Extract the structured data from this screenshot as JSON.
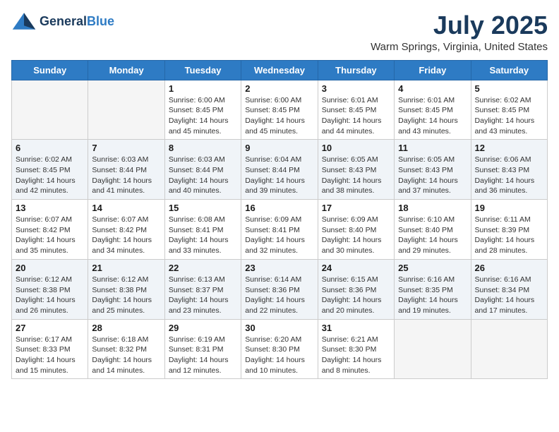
{
  "header": {
    "logo_general": "General",
    "logo_blue": "Blue",
    "month_year": "July 2025",
    "location": "Warm Springs, Virginia, United States"
  },
  "days_of_week": [
    "Sunday",
    "Monday",
    "Tuesday",
    "Wednesday",
    "Thursday",
    "Friday",
    "Saturday"
  ],
  "weeks": [
    [
      {
        "day": "",
        "empty": true
      },
      {
        "day": "",
        "empty": true
      },
      {
        "day": "1",
        "sunrise": "Sunrise: 6:00 AM",
        "sunset": "Sunset: 8:45 PM",
        "daylight": "Daylight: 14 hours and 45 minutes."
      },
      {
        "day": "2",
        "sunrise": "Sunrise: 6:00 AM",
        "sunset": "Sunset: 8:45 PM",
        "daylight": "Daylight: 14 hours and 45 minutes."
      },
      {
        "day": "3",
        "sunrise": "Sunrise: 6:01 AM",
        "sunset": "Sunset: 8:45 PM",
        "daylight": "Daylight: 14 hours and 44 minutes."
      },
      {
        "day": "4",
        "sunrise": "Sunrise: 6:01 AM",
        "sunset": "Sunset: 8:45 PM",
        "daylight": "Daylight: 14 hours and 43 minutes."
      },
      {
        "day": "5",
        "sunrise": "Sunrise: 6:02 AM",
        "sunset": "Sunset: 8:45 PM",
        "daylight": "Daylight: 14 hours and 43 minutes."
      }
    ],
    [
      {
        "day": "6",
        "sunrise": "Sunrise: 6:02 AM",
        "sunset": "Sunset: 8:45 PM",
        "daylight": "Daylight: 14 hours and 42 minutes."
      },
      {
        "day": "7",
        "sunrise": "Sunrise: 6:03 AM",
        "sunset": "Sunset: 8:44 PM",
        "daylight": "Daylight: 14 hours and 41 minutes."
      },
      {
        "day": "8",
        "sunrise": "Sunrise: 6:03 AM",
        "sunset": "Sunset: 8:44 PM",
        "daylight": "Daylight: 14 hours and 40 minutes."
      },
      {
        "day": "9",
        "sunrise": "Sunrise: 6:04 AM",
        "sunset": "Sunset: 8:44 PM",
        "daylight": "Daylight: 14 hours and 39 minutes."
      },
      {
        "day": "10",
        "sunrise": "Sunrise: 6:05 AM",
        "sunset": "Sunset: 8:43 PM",
        "daylight": "Daylight: 14 hours and 38 minutes."
      },
      {
        "day": "11",
        "sunrise": "Sunrise: 6:05 AM",
        "sunset": "Sunset: 8:43 PM",
        "daylight": "Daylight: 14 hours and 37 minutes."
      },
      {
        "day": "12",
        "sunrise": "Sunrise: 6:06 AM",
        "sunset": "Sunset: 8:43 PM",
        "daylight": "Daylight: 14 hours and 36 minutes."
      }
    ],
    [
      {
        "day": "13",
        "sunrise": "Sunrise: 6:07 AM",
        "sunset": "Sunset: 8:42 PM",
        "daylight": "Daylight: 14 hours and 35 minutes."
      },
      {
        "day": "14",
        "sunrise": "Sunrise: 6:07 AM",
        "sunset": "Sunset: 8:42 PM",
        "daylight": "Daylight: 14 hours and 34 minutes."
      },
      {
        "day": "15",
        "sunrise": "Sunrise: 6:08 AM",
        "sunset": "Sunset: 8:41 PM",
        "daylight": "Daylight: 14 hours and 33 minutes."
      },
      {
        "day": "16",
        "sunrise": "Sunrise: 6:09 AM",
        "sunset": "Sunset: 8:41 PM",
        "daylight": "Daylight: 14 hours and 32 minutes."
      },
      {
        "day": "17",
        "sunrise": "Sunrise: 6:09 AM",
        "sunset": "Sunset: 8:40 PM",
        "daylight": "Daylight: 14 hours and 30 minutes."
      },
      {
        "day": "18",
        "sunrise": "Sunrise: 6:10 AM",
        "sunset": "Sunset: 8:40 PM",
        "daylight": "Daylight: 14 hours and 29 minutes."
      },
      {
        "day": "19",
        "sunrise": "Sunrise: 6:11 AM",
        "sunset": "Sunset: 8:39 PM",
        "daylight": "Daylight: 14 hours and 28 minutes."
      }
    ],
    [
      {
        "day": "20",
        "sunrise": "Sunrise: 6:12 AM",
        "sunset": "Sunset: 8:38 PM",
        "daylight": "Daylight: 14 hours and 26 minutes."
      },
      {
        "day": "21",
        "sunrise": "Sunrise: 6:12 AM",
        "sunset": "Sunset: 8:38 PM",
        "daylight": "Daylight: 14 hours and 25 minutes."
      },
      {
        "day": "22",
        "sunrise": "Sunrise: 6:13 AM",
        "sunset": "Sunset: 8:37 PM",
        "daylight": "Daylight: 14 hours and 23 minutes."
      },
      {
        "day": "23",
        "sunrise": "Sunrise: 6:14 AM",
        "sunset": "Sunset: 8:36 PM",
        "daylight": "Daylight: 14 hours and 22 minutes."
      },
      {
        "day": "24",
        "sunrise": "Sunrise: 6:15 AM",
        "sunset": "Sunset: 8:36 PM",
        "daylight": "Daylight: 14 hours and 20 minutes."
      },
      {
        "day": "25",
        "sunrise": "Sunrise: 6:16 AM",
        "sunset": "Sunset: 8:35 PM",
        "daylight": "Daylight: 14 hours and 19 minutes."
      },
      {
        "day": "26",
        "sunrise": "Sunrise: 6:16 AM",
        "sunset": "Sunset: 8:34 PM",
        "daylight": "Daylight: 14 hours and 17 minutes."
      }
    ],
    [
      {
        "day": "27",
        "sunrise": "Sunrise: 6:17 AM",
        "sunset": "Sunset: 8:33 PM",
        "daylight": "Daylight: 14 hours and 15 minutes."
      },
      {
        "day": "28",
        "sunrise": "Sunrise: 6:18 AM",
        "sunset": "Sunset: 8:32 PM",
        "daylight": "Daylight: 14 hours and 14 minutes."
      },
      {
        "day": "29",
        "sunrise": "Sunrise: 6:19 AM",
        "sunset": "Sunset: 8:31 PM",
        "daylight": "Daylight: 14 hours and 12 minutes."
      },
      {
        "day": "30",
        "sunrise": "Sunrise: 6:20 AM",
        "sunset": "Sunset: 8:30 PM",
        "daylight": "Daylight: 14 hours and 10 minutes."
      },
      {
        "day": "31",
        "sunrise": "Sunrise: 6:21 AM",
        "sunset": "Sunset: 8:30 PM",
        "daylight": "Daylight: 14 hours and 8 minutes."
      },
      {
        "day": "",
        "empty": true
      },
      {
        "day": "",
        "empty": true
      }
    ]
  ]
}
